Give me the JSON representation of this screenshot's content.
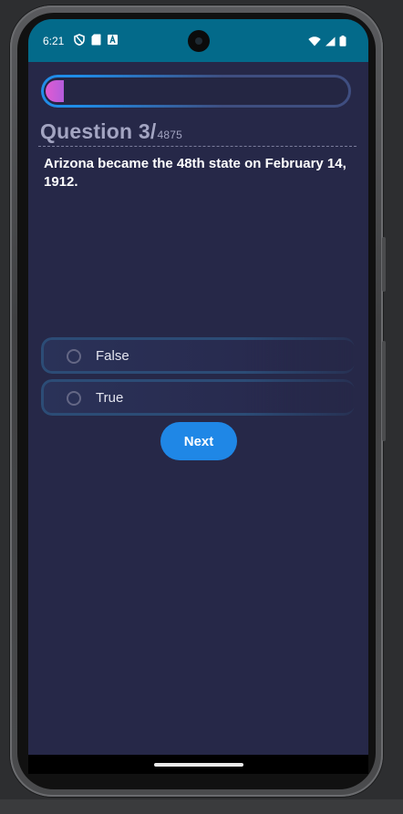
{
  "status_bar": {
    "time": "6:21",
    "left_icons": [
      "shield-icon",
      "sd-card-icon",
      "text-a-icon"
    ],
    "right_icons": [
      "wifi-icon",
      "signal-icon",
      "battery-icon"
    ]
  },
  "quiz": {
    "progress": 0.0006,
    "question_label": "Question 3/",
    "question_total": "4875",
    "question_text": "Arizona became the 48th state on February 14, 1912.",
    "options": [
      {
        "label": "False",
        "selected": false
      },
      {
        "label": "True",
        "selected": false
      }
    ],
    "next_label": "Next"
  },
  "colors": {
    "status_bar": "#036a8a",
    "background": "#262848",
    "accent": "#1f87e6",
    "progress_fill": "#e05bd2"
  }
}
